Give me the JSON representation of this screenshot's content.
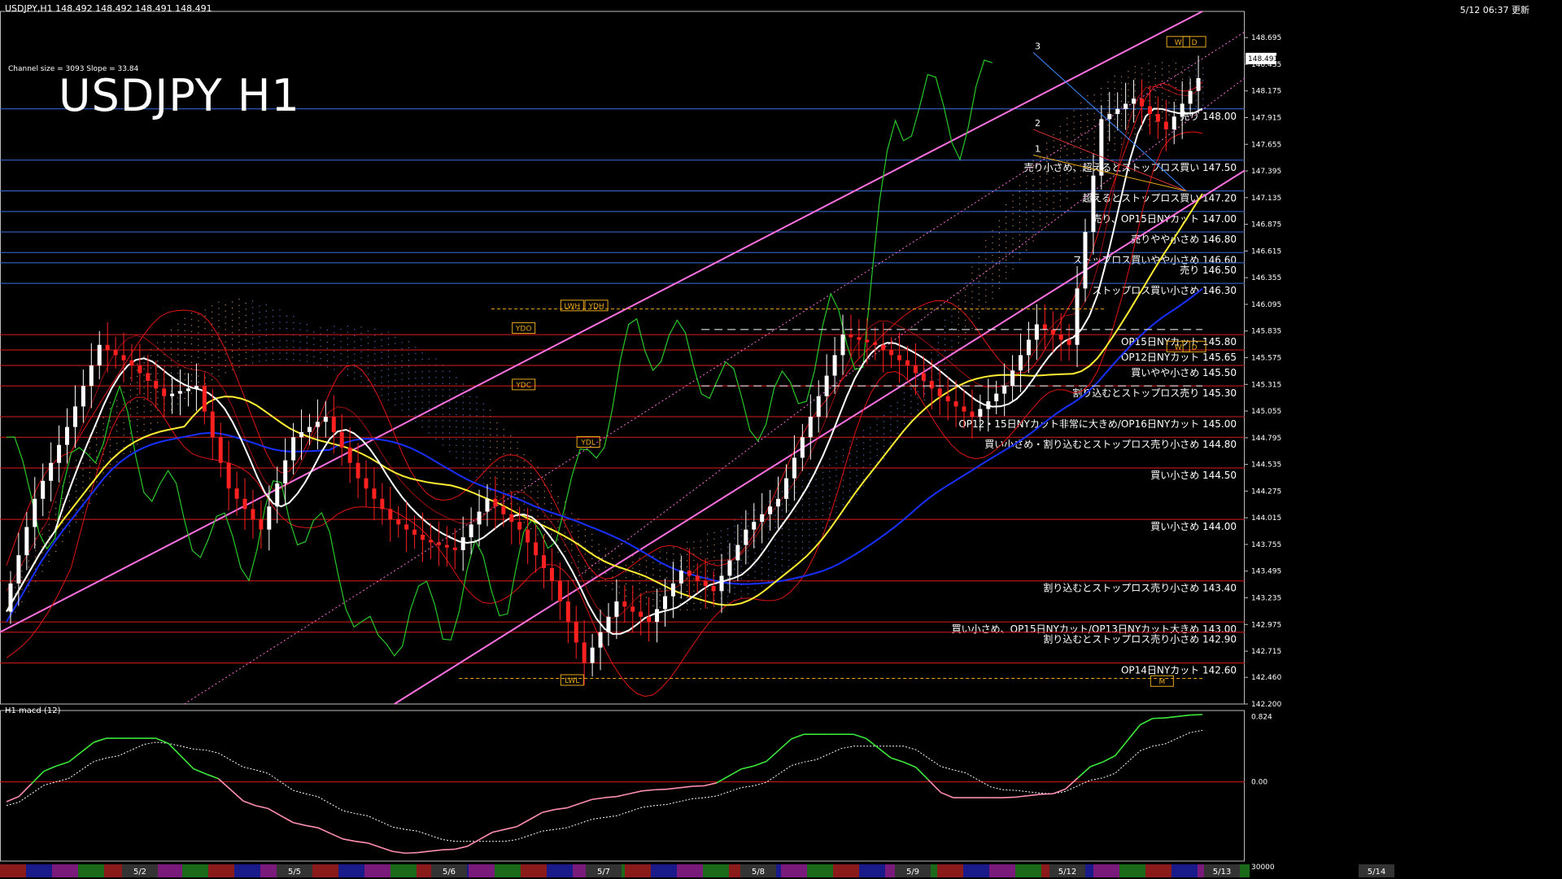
{
  "header": {
    "symbol_info": "USDJPY,H1  148.492 148.492 148.491 148.491",
    "update_time": "5/12 06:37 更新",
    "channel_info": "Channel size = 3093 Slope = 33.84",
    "big_title": "USDJPY H1",
    "macd_title": "H1 macd (12)"
  },
  "chart_data": [
    {
      "type": "line",
      "title": "USDJPY H1",
      "ylim": [
        142.2,
        148.95
      ],
      "y_ticks": [
        "148.695",
        "148.435",
        "148.175",
        "147.915",
        "147.655",
        "147.395",
        "147.135",
        "146.875",
        "146.615",
        "146.355",
        "146.095",
        "145.835",
        "145.575",
        "145.315",
        "145.055",
        "144.795",
        "144.535",
        "144.275",
        "144.015",
        "143.755",
        "143.495",
        "143.235",
        "142.975",
        "142.715",
        "142.460",
        "142.200"
      ],
      "current_price": "148.491",
      "x_date_labels": [
        "5/2",
        "5/5",
        "5/6",
        "5/7",
        "5/8",
        "5/9",
        "5/12",
        "5/13",
        "5/14"
      ],
      "close_path": [
        {
          "t": 0,
          "y": 143.1
        },
        {
          "t": 4,
          "y": 144.2
        },
        {
          "t": 8,
          "y": 144.9
        },
        {
          "t": 12,
          "y": 145.7
        },
        {
          "t": 16,
          "y": 145.5
        },
        {
          "t": 20,
          "y": 145.2
        },
        {
          "t": 24,
          "y": 145.3
        },
        {
          "t": 28,
          "y": 144.3
        },
        {
          "t": 32,
          "y": 143.9
        },
        {
          "t": 36,
          "y": 144.8
        },
        {
          "t": 40,
          "y": 145.0
        },
        {
          "t": 44,
          "y": 144.4
        },
        {
          "t": 48,
          "y": 144.0
        },
        {
          "t": 52,
          "y": 143.8
        },
        {
          "t": 56,
          "y": 143.7
        },
        {
          "t": 60,
          "y": 144.2
        },
        {
          "t": 64,
          "y": 143.9
        },
        {
          "t": 68,
          "y": 143.4
        },
        {
          "t": 72,
          "y": 142.6
        },
        {
          "t": 76,
          "y": 143.2
        },
        {
          "t": 80,
          "y": 143.0
        },
        {
          "t": 84,
          "y": 143.5
        },
        {
          "t": 88,
          "y": 143.3
        },
        {
          "t": 92,
          "y": 143.9
        },
        {
          "t": 96,
          "y": 144.2
        },
        {
          "t": 100,
          "y": 145.0
        },
        {
          "t": 104,
          "y": 145.8
        },
        {
          "t": 108,
          "y": 145.7
        },
        {
          "t": 112,
          "y": 145.5
        },
        {
          "t": 116,
          "y": 145.2
        },
        {
          "t": 120,
          "y": 145.0
        },
        {
          "t": 124,
          "y": 145.3
        },
        {
          "t": 128,
          "y": 145.9
        },
        {
          "t": 132,
          "y": 145.7
        },
        {
          "t": 136,
          "y": 147.9
        },
        {
          "t": 140,
          "y": 148.1
        },
        {
          "t": 144,
          "y": 147.8
        },
        {
          "t": 148,
          "y": 148.3
        }
      ],
      "levels": [
        {
          "price": 148.0,
          "label": "売り 148.00",
          "kind": "sell"
        },
        {
          "price": 147.5,
          "label": "売り小さめ、超えるとストップロス買い 147.50",
          "kind": "sell"
        },
        {
          "price": 147.2,
          "label": "超えるとストップロス買い 147.20",
          "kind": "sell"
        },
        {
          "price": 147.0,
          "label": "売り、OP15日NYカット 147.00",
          "kind": "sell"
        },
        {
          "price": 146.8,
          "label": "売りやや小さめ 146.80",
          "kind": "sell"
        },
        {
          "price": 146.6,
          "label": "ストップロス買いやや小さめ 146.60",
          "kind": "sell"
        },
        {
          "price": 146.5,
          "label": "売り 146.50",
          "kind": "sell"
        },
        {
          "price": 146.3,
          "label": "ストップロス買い小さめ 146.30",
          "kind": "sell"
        },
        {
          "price": 145.8,
          "label": "OP15日NYカット 145.80",
          "kind": "buy"
        },
        {
          "price": 145.65,
          "label": "OP12日NYカット 145.65",
          "kind": "buy"
        },
        {
          "price": 145.5,
          "label": "買いやや小さめ 145.50",
          "kind": "buy"
        },
        {
          "price": 145.3,
          "label": "割り込むとストップロス売り 145.30",
          "kind": "buy"
        },
        {
          "price": 145.0,
          "label": "OP12・15日NYカット非常に大きめ/OP16日NYカット 145.00",
          "kind": "buy"
        },
        {
          "price": 144.8,
          "label": "買い小さめ・割り込むとストップロス売り小さめ 144.80",
          "kind": "buy"
        },
        {
          "price": 144.5,
          "label": "買い小さめ 144.50",
          "kind": "buy"
        },
        {
          "price": 144.0,
          "label": "買い小さめ 144.00",
          "kind": "buy"
        },
        {
          "price": 143.4,
          "label": "割り込むとストップロス売り小さめ 143.40",
          "kind": "buy"
        },
        {
          "price": 143.0,
          "label": "買い小さめ、OP15日NYカット/OP13日NYカット大きめ 143.00",
          "kind": "buy"
        },
        {
          "price": 142.9,
          "label": "割り込むとストップロス売り小さめ 142.90",
          "kind": "buy"
        },
        {
          "price": 142.6,
          "label": "OP14日NYカット 142.60",
          "kind": "buy"
        }
      ],
      "markers": {
        "lwh": "LWH",
        "ydh": "YDH",
        "ydo": "YDO",
        "ydc": "YDC",
        "ydl": "YDL",
        "lwl": "LWL",
        "w": "W",
        "d": "D",
        "m": "M",
        "fib_1": "1",
        "fib_2": "2",
        "fib_3": "3"
      }
    },
    {
      "type": "line",
      "title": "H1 macd (12)",
      "ylim": [
        -1.0,
        0.9
      ],
      "y_ticks": [
        "0.824",
        "0.00"
      ],
      "bottom_value": "30000",
      "series": [
        {
          "values": [
            -0.25,
            0.2,
            0.55,
            0.55,
            0.1,
            -0.3,
            -0.55,
            -0.75,
            -0.9,
            -0.85,
            -0.6,
            -0.35,
            -0.2,
            -0.1,
            -0.05,
            0.2,
            0.6,
            0.6,
            0.25,
            -0.2,
            -0.2,
            -0.15,
            0.25,
            0.8,
            0.85
          ]
        },
        {
          "values": [
            -0.3,
            0.0,
            0.3,
            0.5,
            0.4,
            0.15,
            -0.15,
            -0.4,
            -0.6,
            -0.75,
            -0.75,
            -0.6,
            -0.45,
            -0.3,
            -0.2,
            -0.05,
            0.25,
            0.45,
            0.45,
            0.15,
            -0.1,
            -0.15,
            0.05,
            0.45,
            0.65
          ]
        }
      ]
    }
  ],
  "colors": {
    "sell_line": "#3d6fe0",
    "buy_line": "#d81c1c",
    "channel": "#ff70e0",
    "ma_white": "#ffffff",
    "ma_yellow": "#ffee33",
    "ma_blue": "#1830ff",
    "chikou": "#28c828",
    "kumo_up": "#ffb070",
    "kumo_down": "#6f90ff",
    "bollinger": "#e01414",
    "marker": "#e8a818"
  }
}
